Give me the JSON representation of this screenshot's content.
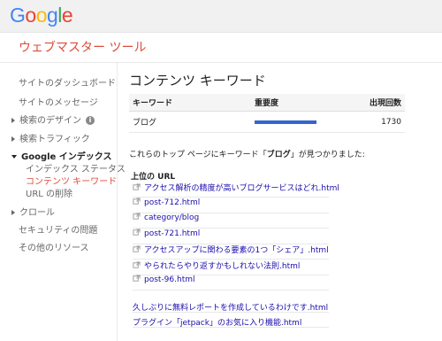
{
  "header": {
    "logo_letters": [
      {
        "ch": "G",
        "color": "#4285f4"
      },
      {
        "ch": "o",
        "color": "#ea4335"
      },
      {
        "ch": "o",
        "color": "#fbbc05"
      },
      {
        "ch": "g",
        "color": "#4285f4"
      },
      {
        "ch": "l",
        "color": "#34a853"
      },
      {
        "ch": "e",
        "color": "#ea4335"
      }
    ],
    "app_title": "ウェブマスター ツール"
  },
  "sidebar": {
    "items": [
      {
        "label": "サイトのダッシュボード"
      },
      {
        "label": "サイトのメッセージ"
      },
      {
        "label": "検索のデザイン"
      },
      {
        "label": "検索トラフィック"
      },
      {
        "label": "Google インデックス"
      },
      {
        "label": "インデックス ステータス"
      },
      {
        "label": "コンテンツ キーワード"
      },
      {
        "label": "URL の削除"
      },
      {
        "label": "クロール"
      },
      {
        "label": "セキュリティの問題"
      },
      {
        "label": "その他のリソース"
      }
    ],
    "info_glyph": "i"
  },
  "main": {
    "title": "コンテンツ キーワード",
    "table": {
      "headers": [
        "キーワード",
        "重要度",
        "出現回数"
      ],
      "rows": [
        {
          "keyword": "ブログ",
          "importance_fraction": 1.0,
          "count": "1730"
        }
      ]
    },
    "found_prefix": "これらのトップ ページにキーワード「",
    "found_keyword": "ブログ",
    "found_suffix": "」が見つかりました:",
    "urls_header": "上位の URL",
    "urls": [
      "アクセス解析の精度が高いブログサービスはどれ.html",
      "post-712.html",
      "category/blog",
      "post-721.html",
      "アクセスアップに関わる要素の1つ「シェア」.html",
      "やられたらやり返すかもしれない法則.html",
      "post-96.html"
    ],
    "more_urls": [
      "久しぶりに無料レポートを作成しているわけです.html",
      "プラグイン「jetpack」のお気に入り機能.html"
    ]
  },
  "colors": {
    "accent": "#dd4b39",
    "link": "#1a0dab",
    "importance_bar": "#3366cc"
  }
}
